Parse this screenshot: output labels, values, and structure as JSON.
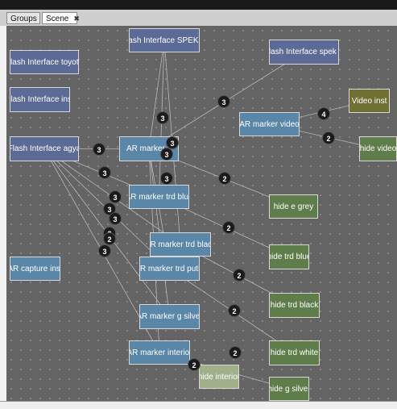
{
  "tabs": [
    {
      "label": "Groups",
      "active": false
    },
    {
      "label": "Scene",
      "active": true,
      "close_glyph": "✖"
    }
  ],
  "colors": {
    "canvas": "#646464",
    "node_flash": "#5c6a96",
    "node_ar": "#5a86a8",
    "node_hide": "#5e7d4b",
    "node_video_inst": "#6f7031",
    "node_hide_interior": "#9fb08b",
    "badge": "#1b1b1b",
    "edge": "#b8b8b8"
  },
  "nodes": {
    "flash_spekg": {
      "label": "Flash Interface SPEK G",
      "kind": "flash"
    },
    "flash_speke": {
      "label": "Flash Interface spek E",
      "kind": "flash"
    },
    "flash_toyota": {
      "label": "Flash Interface toyota",
      "kind": "flash"
    },
    "flash_inst": {
      "label": "Flash Interface inst",
      "kind": "flash"
    },
    "flash_agya": {
      "label": "Flash Interface agya",
      "kind": "flash"
    },
    "ar_video": {
      "label": "AR marker video",
      "kind": "ar"
    },
    "video_inst": {
      "label": "Video inst",
      "kind": "video_inst"
    },
    "hide_video": {
      "label": "hide video",
      "kind": "hide"
    },
    "ar_a": {
      "label": "AR marker a",
      "kind": "ar"
    },
    "ar_trd_blue": {
      "label": "AR marker trd blue",
      "kind": "ar"
    },
    "hide_e_grey": {
      "label": "hide e grey",
      "kind": "hide"
    },
    "ar_trd_black": {
      "label": "AR marker trd black",
      "kind": "ar"
    },
    "hide_trd_blue": {
      "label": "hide trd blue",
      "kind": "hide"
    },
    "ar_capture": {
      "label": "AR capture inst",
      "kind": "ar"
    },
    "ar_trd_putih": {
      "label": "AR marker trd putih",
      "kind": "ar"
    },
    "hide_trd_black": {
      "label": "hide trd black",
      "kind": "hide"
    },
    "ar_g_silver": {
      "label": "AR marker g silver",
      "kind": "ar"
    },
    "ar_interior": {
      "label": "AR marker interior",
      "kind": "ar"
    },
    "hide_trd_white": {
      "label": "hide trd white",
      "kind": "hide"
    },
    "hide_interior": {
      "label": "hide interior",
      "kind": "hide_interior"
    },
    "hide_g_silver": {
      "label": "hide g silver",
      "kind": "hide"
    }
  },
  "badges": [
    "3",
    "3",
    "3",
    "3",
    "3",
    "3",
    "3",
    "3",
    "3",
    "3",
    "3",
    "3",
    "4",
    "2",
    "2",
    "2",
    "2",
    "2",
    "2",
    "2",
    "2"
  ],
  "edges": [
    [
      "flash_spekg",
      "ar_a"
    ],
    [
      "flash_spekg",
      "ar_trd_blue"
    ],
    [
      "flash_spekg",
      "ar_trd_black"
    ],
    [
      "flash_speke",
      "ar_a"
    ],
    [
      "flash_agya",
      "ar_a"
    ],
    [
      "flash_agya",
      "ar_trd_black"
    ],
    [
      "flash_agya",
      "ar_trd_putih"
    ],
    [
      "flash_agya",
      "ar_g_silver"
    ],
    [
      "flash_agya",
      "ar_interior"
    ],
    [
      "flash_agya",
      "ar_trd_blue"
    ],
    [
      "ar_video",
      "video_inst"
    ],
    [
      "ar_video",
      "hide_video"
    ],
    [
      "ar_a",
      "hide_e_grey"
    ],
    [
      "ar_a",
      "ar_trd_putih"
    ],
    [
      "ar_a",
      "ar_g_silver"
    ],
    [
      "ar_a",
      "ar_interior"
    ],
    [
      "ar_trd_blue",
      "hide_trd_blue"
    ],
    [
      "ar_trd_black",
      "hide_trd_black"
    ],
    [
      "ar_trd_putih",
      "hide_trd_white"
    ],
    [
      "ar_interior",
      "hide_interior"
    ],
    [
      "ar_interior",
      "hide_g_silver"
    ]
  ]
}
